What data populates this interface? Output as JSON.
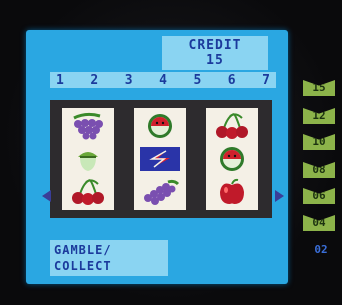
{
  "credit": {
    "label": "CREDIT",
    "value": "15"
  },
  "lines": [
    "1",
    "2",
    "3",
    "4",
    "5",
    "6",
    "7"
  ],
  "reels": [
    [
      "grapes-icon",
      "acorn-icon",
      "cherries-icon"
    ],
    [
      "watermelon-icon",
      "lucky-s-icon",
      "grapes-icon"
    ],
    [
      "cherries-icon",
      "watermelon-icon",
      "apple-icon"
    ]
  ],
  "gamble": {
    "line1": "GAMBLE/",
    "line2": "COLLECT"
  },
  "ladder": [
    "15",
    "12",
    "10",
    "08",
    "06",
    "04"
  ],
  "ladder_status": "02",
  "colors": {
    "screen": "#2aa7e2",
    "panel": "#8ad4f2",
    "text": "#1b3a9c",
    "ladder": "#8cb34a"
  }
}
